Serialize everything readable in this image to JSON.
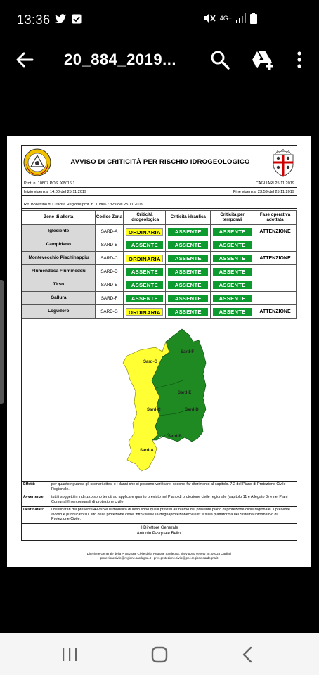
{
  "status_bar": {
    "time": "13:36",
    "network_label": "4G+",
    "icons": [
      "twitter-icon",
      "download-done-icon",
      "mute-icon",
      "signal-icon",
      "battery-icon"
    ]
  },
  "app_bar": {
    "title": "20_884_2019...",
    "icons": [
      "back-arrow-icon",
      "search-icon",
      "google-drive-add-icon",
      "more-vert-icon"
    ]
  },
  "document": {
    "title": "AVVISO DI CRITICITÀ PER RISCHIO IDROGEOLOGICO",
    "logo_left_text": "REGIONE SARDEGNA",
    "prot": "Prot. n. 10807 POS. XIV.16.1",
    "place_date": "CAGLIARI 25.11.2019",
    "start": "Inizio vigenza: 14:00 del 25.11.2019",
    "end": "Fine vigenza: 23:59 del 25.11.2019",
    "bulletin_ref": "Rif. Bollettino di Criticità Regione prot. n. 10806 / 329 del 25.11.2019",
    "table": {
      "headers": [
        "Zone di allerta",
        "Codice Zona",
        "Criticità idrogeologica",
        "Criticità idraulica",
        "Criticità per temporali",
        "Fase operativa adottata"
      ],
      "rows": [
        {
          "zone": "Iglesiente",
          "code": "SARD-A",
          "idro": "ORDINARIA",
          "idraulica": "ASSENTE",
          "temporali": "ASSENTE",
          "fase": "ATTENZIONE"
        },
        {
          "zone": "Campidano",
          "code": "SARD-B",
          "idro": "ASSENTE",
          "idraulica": "ASSENTE",
          "temporali": "ASSENTE",
          "fase": ""
        },
        {
          "zone": "Montevecchio Pischinappiu",
          "code": "SARD-C",
          "idro": "ORDINARIA",
          "idraulica": "ASSENTE",
          "temporali": "ASSENTE",
          "fase": "ATTENZIONE"
        },
        {
          "zone": "Flumendosa Flumineddu",
          "code": "SARD-D",
          "idro": "ASSENTE",
          "idraulica": "ASSENTE",
          "temporali": "ASSENTE",
          "fase": ""
        },
        {
          "zone": "Tirso",
          "code": "SARD-E",
          "idro": "ASSENTE",
          "idraulica": "ASSENTE",
          "temporali": "ASSENTE",
          "fase": ""
        },
        {
          "zone": "Gallura",
          "code": "SARD-F",
          "idro": "ASSENTE",
          "idraulica": "ASSENTE",
          "temporali": "ASSENTE",
          "fase": ""
        },
        {
          "zone": "Logudoro",
          "code": "SARD-G",
          "idro": "ORDINARIA",
          "idraulica": "ASSENTE",
          "temporali": "ASSENTE",
          "fase": "ATTENZIONE"
        }
      ]
    },
    "map_labels": [
      "Sard-G",
      "Sard-F",
      "Sard-E",
      "Sard-C",
      "Sard-D",
      "Sard-B",
      "Sard-A"
    ],
    "colors": {
      "assente": "#0d9a2f",
      "ordinaria": "#ffff1a",
      "map_green": "#1f8a22",
      "map_yellow": "#ffff33"
    },
    "notes": {
      "effetti_label": "Effetti:",
      "effetti_text": "per quanto riguarda gli scenari attesi e i danni che si possono verificare, occorre far riferimento al capitolo. 7.2 del Piano di Protezione Civile Regionale.",
      "avvertenze_label": "Avvertenze:",
      "avvertenze_text": "tutti i soggetti in indirizzo sono tenuti ad applicare quanto previsto nel Piano di protezione civile regionale (capitolo 11 e Allegato 3) e nei Piani Comunali/Intercomunali di protezione civile.",
      "destinatari_label": "Destinatari:",
      "destinatari_text": "i destinatari del presente Avviso e le modalità di invio sono quelli previsti all'interno del presente piano di protezione civile regionale. Il presente avviso è pubblicato sul sito della protezione civile \"http://www.sardegnaprotezionecivile.it\" e sulla piattaforma del Sistema Informativo di Protezione Civile."
    },
    "signature_line1": "Il Direttore Generale",
    "signature_line2": "Antonio Pasquale Belloi",
    "footer_line1": "Direzione Generale della Protezione Civile della Regione Sardegna, via Vittorio Veneto 28, 09123 Cagliari",
    "footer_line2": "protezionecivile@regione.sardegna.it - pres.protezione.civile@pec.regione.sardegna.it"
  },
  "nav_bar": {
    "icons": [
      "recent-apps-icon",
      "home-icon",
      "back-icon"
    ]
  }
}
